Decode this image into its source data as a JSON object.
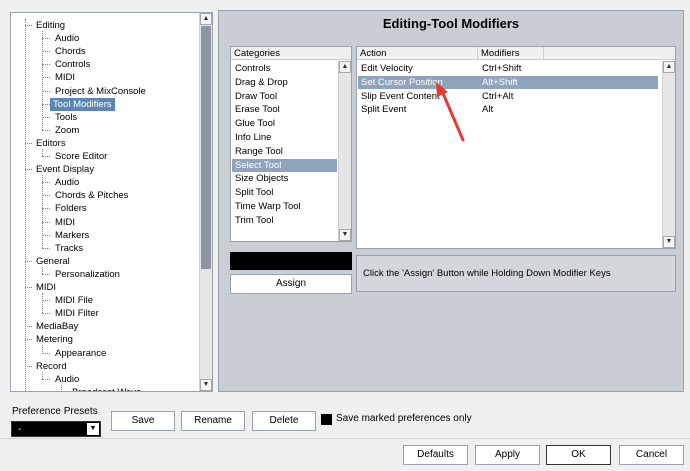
{
  "tree": {
    "items": [
      {
        "label": "Editing",
        "level": 0
      },
      {
        "label": "Audio",
        "level": 1
      },
      {
        "label": "Chords",
        "level": 1
      },
      {
        "label": "Controls",
        "level": 1
      },
      {
        "label": "MIDI",
        "level": 1
      },
      {
        "label": "Project & MixConsole",
        "level": 1
      },
      {
        "label": "Tool Modifiers",
        "level": 1,
        "selected": true
      },
      {
        "label": "Tools",
        "level": 1
      },
      {
        "label": "Zoom",
        "level": 1
      },
      {
        "label": "Editors",
        "level": 0
      },
      {
        "label": "Score Editor",
        "level": 1
      },
      {
        "label": "Event Display",
        "level": 0
      },
      {
        "label": "Audio",
        "level": 1
      },
      {
        "label": "Chords & Pitches",
        "level": 1
      },
      {
        "label": "Folders",
        "level": 1
      },
      {
        "label": "MIDI",
        "level": 1
      },
      {
        "label": "Markers",
        "level": 1
      },
      {
        "label": "Tracks",
        "level": 1
      },
      {
        "label": "General",
        "level": 0
      },
      {
        "label": "Personalization",
        "level": 1
      },
      {
        "label": "MIDI",
        "level": 0
      },
      {
        "label": "MIDI File",
        "level": 1
      },
      {
        "label": "MIDI Filter",
        "level": 1
      },
      {
        "label": "MediaBay",
        "level": 0
      },
      {
        "label": "Metering",
        "level": 0
      },
      {
        "label": "Appearance",
        "level": 1
      },
      {
        "label": "Record",
        "level": 0
      },
      {
        "label": "Audio",
        "level": 1
      },
      {
        "label": "Broadcast Wave",
        "level": 2
      }
    ]
  },
  "panel": {
    "title": "Editing-Tool Modifiers",
    "categories_header": "Categories",
    "categories": [
      "Controls",
      "Drag & Drop",
      "Draw Tool",
      "Erase Tool",
      "Glue Tool",
      "Info Line",
      "Range Tool",
      "Select Tool",
      "Size Objects",
      "Split Tool",
      "Time Warp Tool",
      "Trim Tool"
    ],
    "selected_category": "Select Tool",
    "action_header": "Action",
    "modifiers_header": "Modifiers",
    "actions": [
      {
        "action": "Edit Velocity",
        "modifiers": "Ctrl+Shift"
      },
      {
        "action": "Set Cursor Position",
        "modifiers": "Alt+Shift",
        "selected": true
      },
      {
        "action": "Slip Event Content",
        "modifiers": "Ctrl+Alt"
      },
      {
        "action": "Split Event",
        "modifiers": "Alt"
      }
    ],
    "assign_label": "Assign",
    "hint_text": "Click the 'Assign' Button while Holding Down Modifier Keys"
  },
  "presets": {
    "label": "Preference Presets",
    "selected_value": "-",
    "save_label": "Save",
    "rename_label": "Rename",
    "delete_label": "Delete",
    "save_marked_label": "Save marked preferences only"
  },
  "footer": {
    "defaults_label": "Defaults",
    "apply_label": "Apply",
    "ok_label": "OK",
    "cancel_label": "Cancel"
  },
  "colors": {
    "selection": "#8ea4bd",
    "tree_selection": "#5b87b7",
    "panel_bg": "#c9ced4",
    "annotation_arrow": "#e53935"
  }
}
